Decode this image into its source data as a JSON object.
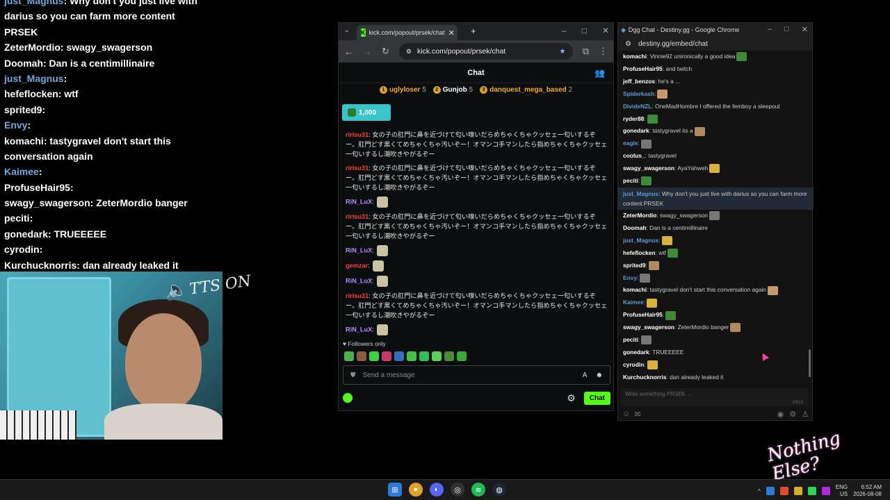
{
  "overlay": {
    "lines": [
      {
        "user": "just_Magnus",
        "text": ": Why don't you just live with",
        "blue": true
      },
      {
        "user": "",
        "text": "darius so you can farm more content"
      },
      {
        "user": "",
        "text": "PRSEK"
      },
      {
        "user": "ZeterMordio",
        "text": ": swagy_swagerson"
      },
      {
        "user": "Doomah",
        "text": ": Dan is a centimillinaire"
      },
      {
        "user": "just_Magnus",
        "text": ":",
        "blue": true
      },
      {
        "user": "hefeflocken",
        "text": ": wtf"
      },
      {
        "user": "sprited9",
        "text": ":"
      },
      {
        "user": "Envy",
        "text": ":",
        "blue": true
      },
      {
        "user": "komachi",
        "text": ": tastygravel don't start this"
      },
      {
        "user": "",
        "text": "conversation again"
      },
      {
        "user": "Kaimee",
        "text": ":",
        "blue": true
      },
      {
        "user": "ProfuseHair95",
        "text": ":"
      },
      {
        "user": "swagy_swagerson",
        "text": ": ZeterMordio banger"
      },
      {
        "user": "peciti",
        "text": ":"
      },
      {
        "user": "gonedark",
        "text": ": TRUEEEEE"
      },
      {
        "user": "cyrodin",
        "text": ":"
      },
      {
        "user": "Kurchucknorris",
        "text": ": dan already leaked it"
      }
    ],
    "tts_text": "TTS ON"
  },
  "kick": {
    "tab_title": "kick.com/popout/prsek/chat",
    "url": "kick.com/popout/prsek/chat",
    "header": "Chat",
    "gifters": [
      {
        "rank": "1",
        "name": "uglyloser",
        "count": "5"
      },
      {
        "rank": "2",
        "name": "Gunjob",
        "count": "5"
      },
      {
        "rank": "3",
        "name": "danquest_mega_based",
        "count": "2"
      }
    ],
    "pinned_amount": "1,000",
    "messages": [
      {
        "user": "ririsu31",
        "color": "red",
        "text": "女の子の肛門に鼻を近づけて匂い嗅いだらめちゃくちゃクッセェ一匂いするぞー。肛門どす黒くてめちゃくちゃ汚いぞー！オマンコ手マンしたら指めちゃくちゃクッセェ一匂いするし潮吹きやがるぞー"
      },
      {
        "user": "ririsu31",
        "color": "red",
        "text": "女の子の肛門に鼻を近づけて匂い嗅いだらめちゃくちゃクッセェ一匂いするぞー。肛門どす黒くてめちゃくちゃ汚いぞー！オマンコ手マンしたら指めちゃくちゃクッセェ一匂いするし潮吹きやがるぞー"
      },
      {
        "user": "RiN_LuX",
        "color": "purple",
        "text": ""
      },
      {
        "user": "ririsu31",
        "color": "red",
        "text": "女の子の肛門に鼻を近づけて匂い嗅いだらめちゃくちゃクッセェ一匂いするぞー。肛門どす黒くてめちゃくちゃ汚いぞー！オマンコ手マンしたら指めちゃくちゃクッセェ一匂いするし潮吹きやがるぞー"
      },
      {
        "user": "RiN_LuX",
        "color": "purple",
        "text": ""
      },
      {
        "user": "gemzar",
        "color": "red",
        "text": ""
      },
      {
        "user": "RiN_LuX",
        "color": "purple",
        "text": ""
      },
      {
        "user": "ririsu31",
        "color": "red",
        "text": "女の子の肛門に鼻を近づけて匂い嗅いだらめちゃくちゃクッセェ一匂いするぞー。肛門どす黒くてめちゃくちゃ汚いぞー！オマンコ手マンしたら指めちゃくちゃクッセェ一匂いするし潮吹きやがるぞー"
      },
      {
        "user": "RiN_LuX",
        "color": "purple",
        "text": ""
      }
    ],
    "followers_only": "Followers only",
    "input_placeholder": "Send a message",
    "chat_button": "Chat"
  },
  "dgg": {
    "window_title": "Dgg Chat - Destiny.gg - Google Chrome",
    "url": "destiny.gg/embed/chat",
    "messages": [
      {
        "user": "komachi",
        "text": ": Vinnie92 unironically a good idea"
      },
      {
        "user": "ProfuseHair95",
        "text": ": and twitch"
      },
      {
        "user": "jeff_benzos",
        "text": ": he's a ..."
      },
      {
        "user": "Spiderkash",
        "text": ":",
        "blue": true
      },
      {
        "user": "DivideNZL",
        "text": ": OneMadHombre I offered the femboy a sleepout",
        "blue": true
      },
      {
        "user": "ryder88",
        "text": ":"
      },
      {
        "user": "gonedark",
        "text": ": tastygravel its a"
      },
      {
        "user": "eagle",
        "text": ":",
        "blue": true
      },
      {
        "user": "coolus_",
        "text": ": tastygravel"
      },
      {
        "user": "swagy_swagerson",
        "text": ": AyaYahweh"
      },
      {
        "user": "peciti",
        "text": ":"
      },
      {
        "user": "just_Magnus",
        "text": ": Why don't you just live with darius so you can farm more content PRSEK",
        "blue": true,
        "hl": true
      },
      {
        "user": "ZeterMordio",
        "text": ": swagy_swagerson"
      },
      {
        "user": "Doomah",
        "text": ": Dan is a centimillinaire"
      },
      {
        "user": "just_Magnus",
        "text": ":",
        "blue": true
      },
      {
        "user": "hefeflocken",
        "text": ": wtf"
      },
      {
        "user": "sprited9",
        "text": ":"
      },
      {
        "user": "Envy",
        "text": ":",
        "blue": true
      },
      {
        "user": "komachi",
        "text": ": tastygravel don't start this conversation again"
      },
      {
        "user": "Kaimee",
        "text": ":",
        "blue": true
      },
      {
        "user": "ProfuseHair95",
        "text": ":"
      },
      {
        "user": "swagy_swagerson",
        "text": ": ZeterMordio banger"
      },
      {
        "user": "peciti",
        "text": ":"
      },
      {
        "user": "gonedark",
        "text": ": TRUEEEEE"
      },
      {
        "user": "cyrodin",
        "text": ":"
      },
      {
        "user": "Kurchucknorris",
        "text": ": dan already leaked it"
      }
    ],
    "input_placeholder": "Write something PRSEK ...",
    "char_count": "0/512"
  },
  "watermark": "Nothing Else?",
  "taskbar": {
    "lang": "ENG",
    "region": "US",
    "time": "6:52 AM",
    "date": "2026-08-08"
  }
}
